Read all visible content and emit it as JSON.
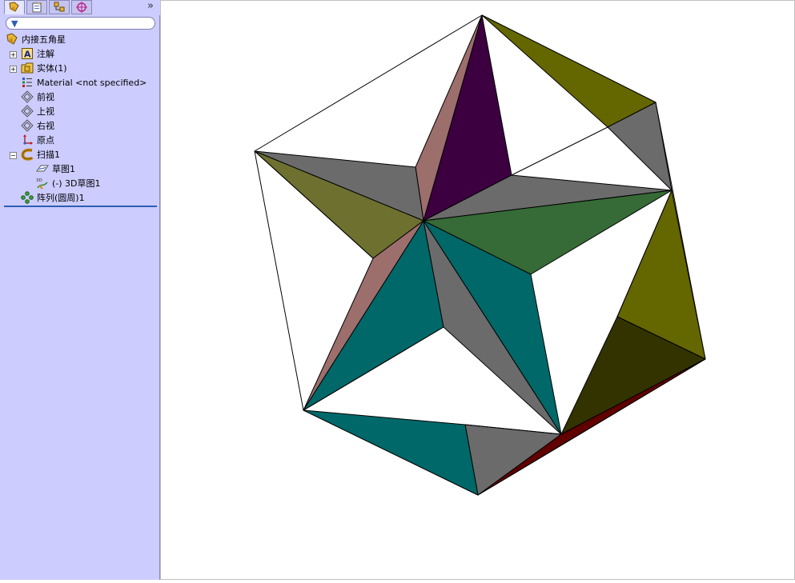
{
  "tree": {
    "root_label": "内接五角星",
    "annotations_label": "注解",
    "solid_bodies_label": "实体(1)",
    "material_label": "Material <not specified>",
    "front_plane_label": "前视",
    "top_plane_label": "上视",
    "right_plane_label": "右视",
    "origin_label": "原点",
    "sweep_label": "扫描1",
    "sketch_label": "草图1",
    "sketch3d_label": "(-) 3D草图1",
    "pattern_label": "阵列(圆周)1"
  },
  "toolbar": {
    "expand_glyph": "»",
    "filter_glyph": "▼"
  },
  "colors": {
    "sidebar_bg": "#ccccff",
    "rollback_bar": "#2d5fb0",
    "faces": [
      "#3c0040",
      "#9c6e6c",
      "#6e7030",
      "#6b6b6b",
      "#366a36",
      "#006868",
      "#646600",
      "#333300",
      "#600000"
    ]
  }
}
